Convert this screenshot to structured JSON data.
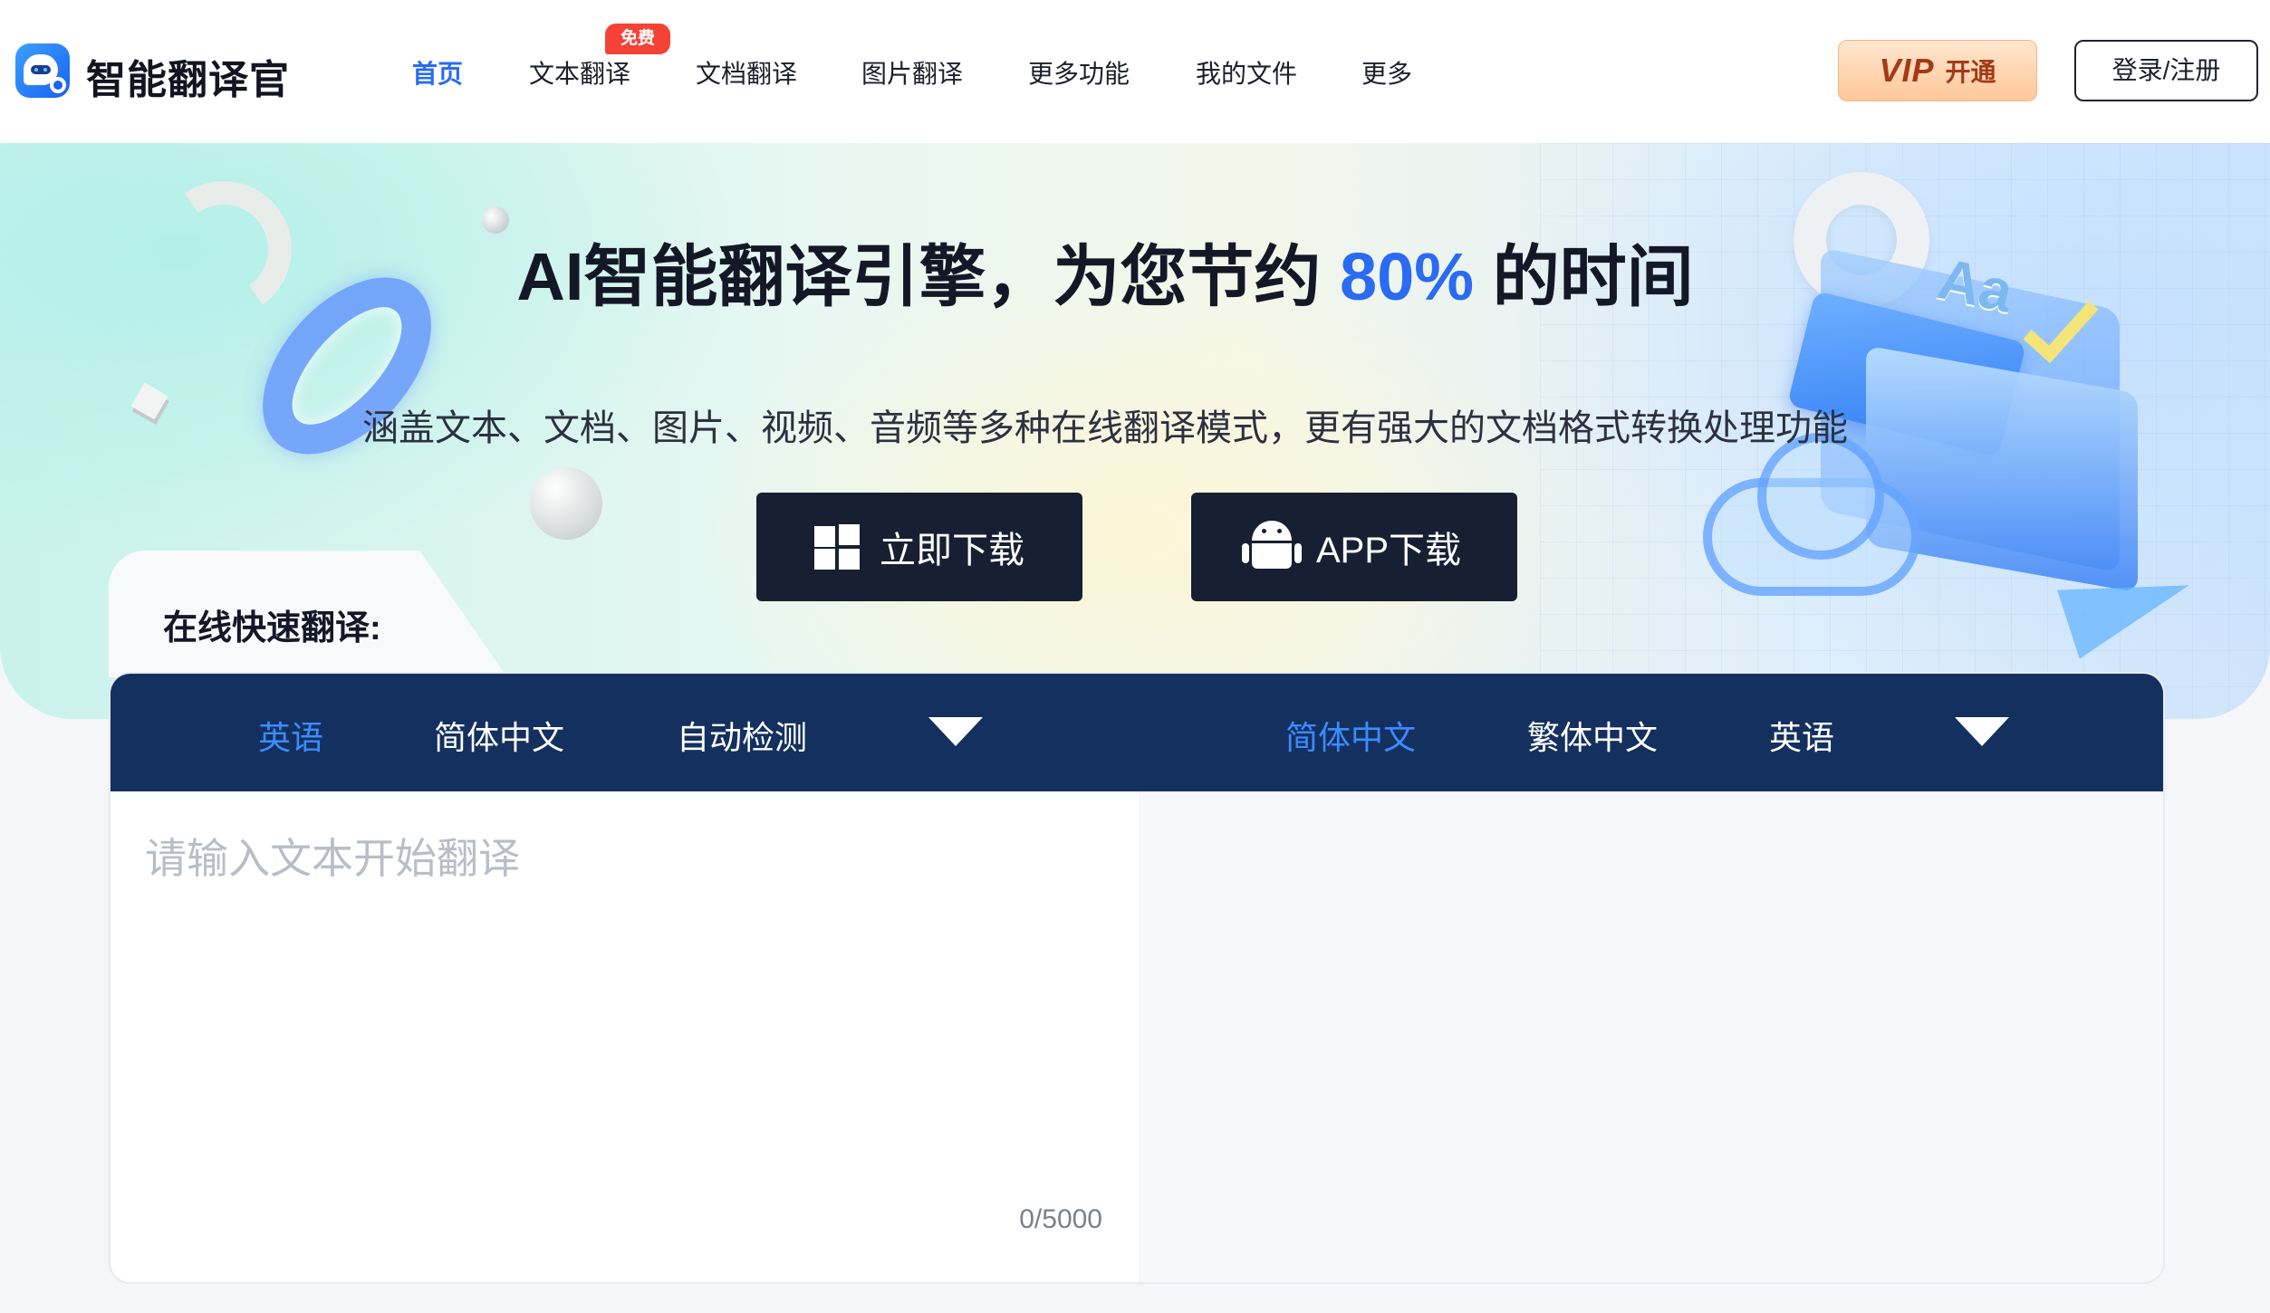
{
  "brand": {
    "name": "智能翻译官",
    "accent": "#2a6bf2"
  },
  "nav": {
    "items": [
      {
        "label": "首页",
        "active": true
      },
      {
        "label": "文本翻译",
        "badge": "免费"
      },
      {
        "label": "文档翻译"
      },
      {
        "label": "图片翻译"
      },
      {
        "label": "更多功能"
      },
      {
        "label": "我的文件"
      },
      {
        "label": "更多"
      }
    ]
  },
  "header": {
    "vip_word": "VIP",
    "vip_open": "开通",
    "login_label": "登录/注册"
  },
  "hero": {
    "title_prefix": "AI智能翻译引擎，为您节约",
    "title_highlight": "80%",
    "title_suffix": "的时间",
    "subtitle": "涵盖文本、文档、图片、视频、音频等多种在线翻译模式，更有强大的文档格式转换处理功能",
    "download_label": "立即下载",
    "app_download_label": "APP下载",
    "decor_text": "Aa"
  },
  "translator": {
    "section_title": "在线快速翻译:",
    "source_langs": [
      "英语",
      "简体中文",
      "自动检测"
    ],
    "target_langs": [
      "简体中文",
      "繁体中文",
      "英语"
    ],
    "placeholder": "请输入文本开始翻译",
    "counter": "0/5000"
  }
}
